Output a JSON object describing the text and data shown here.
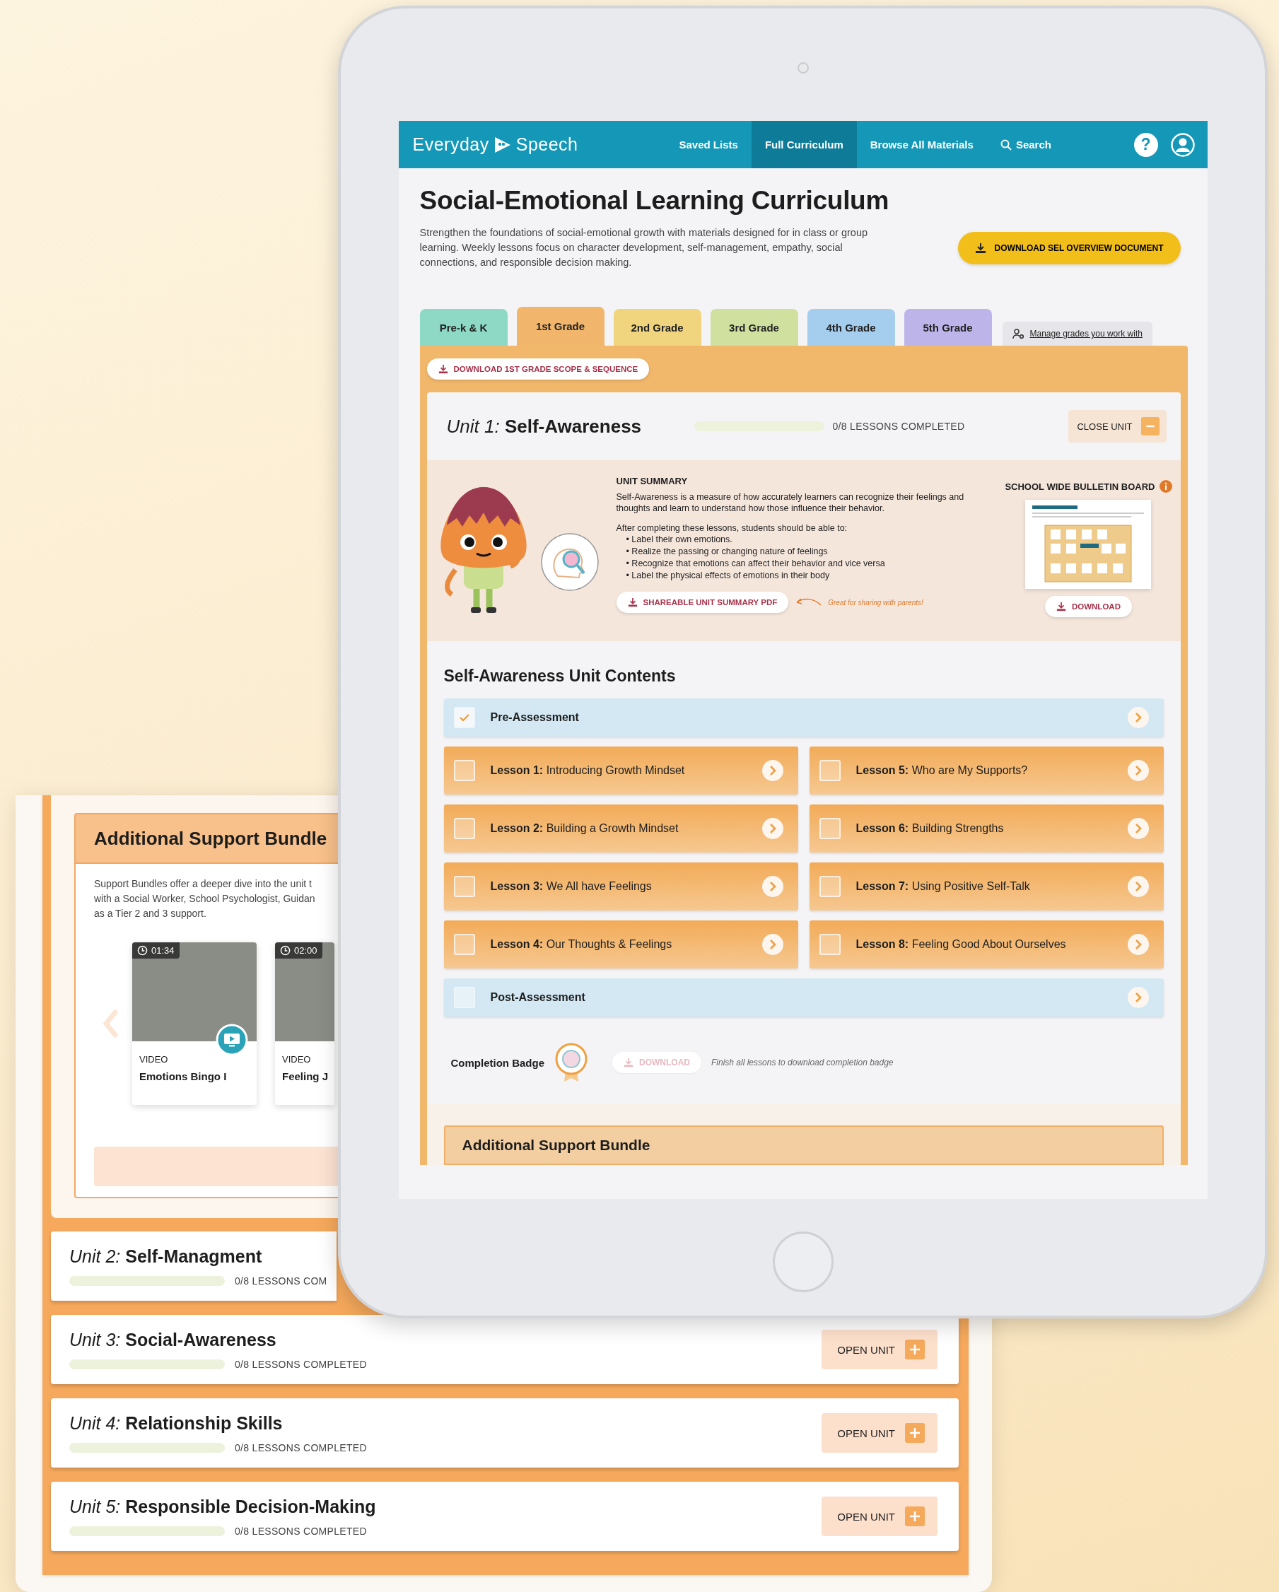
{
  "support_panel": {
    "bundle": {
      "title": "Additional Support Bundle",
      "description": [
        "Support Bundles offer a deeper dive into the unit t",
        "with a Social Worker, School Psychologist, Guidan",
        "as a Tier 2 and 3 support."
      ],
      "videos": [
        {
          "duration": "01:34",
          "type": "VIDEO",
          "title": "Emotions Bingo I",
          "play": true
        },
        {
          "duration": "02:00",
          "type": "VIDEO",
          "title": "Feeling J"
        }
      ]
    },
    "units": [
      {
        "title": "*Unit 2:* **Self-Managment**",
        "level": 0,
        "progress": "0/8 LESSONS COM"
      },
      {
        "title": "*Unit 3:* **Social-Awareness**",
        "level": 0,
        "progress": "0/8 LESSONS COMPLETED",
        "button": "OPEN UNIT"
      },
      {
        "title": "*Unit 4:* **Relationship Skills**",
        "level": 0,
        "progress": "0/8 LESSONS COMPLETED",
        "button": "OPEN UNIT"
      },
      {
        "title": "*Unit 5:* **Responsible Decision-Making**",
        "level": 0,
        "progress": "0/8 LESSONS COMPLETED",
        "button": "OPEN UNIT"
      }
    ]
  },
  "tablet": {
    "nav": {
      "logo_left": "Everyday",
      "logo_right": "Speech",
      "items": [
        {
          "label": "Saved Lists",
          "selected": false
        },
        {
          "label": "Full Curriculum",
          "selected": true
        },
        {
          "label": "Browse All Materials",
          "selected": false
        }
      ],
      "search": "Search",
      "help": "?"
    },
    "title": "Social-Emotional Learning Curriculum",
    "description": "Strengthen the foundations of social-emotional growth with materials designed for in class or group learning. Weekly lessons focus on character development, self-management, empathy, social connections, and responsible decision making.",
    "overview_button": "DOWNLOAD SEL OVERVIEW DOCUMENT",
    "grade_tabs": [
      {
        "label": "Pre-k & K",
        "selected": false,
        "color": "#8ed8c6"
      },
      {
        "label": "1st Grade",
        "selected": true,
        "color": "#f1b66b"
      },
      {
        "label": "2nd Grade",
        "selected": false,
        "color": "#f0d57e"
      },
      {
        "label": "3rd Grade",
        "selected": false,
        "color": "#cfe09f"
      },
      {
        "label": "4th Grade",
        "selected": false,
        "color": "#a4cdee"
      },
      {
        "label": "5th Grade",
        "selected": false,
        "color": "#bdb5ea"
      }
    ],
    "manage_link": "Manage grades you work with",
    "scope_button": "DOWNLOAD 1ST GRADE SCOPE & SEQUENCE",
    "unit": {
      "title": "*Unit 1:* **Self-Awareness**",
      "level": 0,
      "progress": "0/8 LESSONS COMPLETED",
      "close_button": "CLOSE UNIT",
      "summary": {
        "heading": "UNIT SUMMARY",
        "paragraph": "Self-Awareness is a measure of how accurately learners can recognize their feelings and thoughts and learn to understand how those influence their behavior.",
        "intro": "After completing these lessons, students should be able to:",
        "bullets": [
          "• Label their own emotions.",
          "• Realize the passing or changing nature of feelings",
          "• Recognize that emotions can affect their behavior and vice versa",
          "• Label the physical effects of emotions in their body"
        ],
        "pdf_button": "SHAREABLE UNIT SUMMARY PDF",
        "note": "Great for sharing with parents!"
      },
      "bulletin": {
        "title": "SCHOOL WIDE BULLETIN BOARD",
        "button": "DOWNLOAD"
      },
      "contents_heading": "Self-Awareness Unit Contents",
      "items": [
        {
          "kind": "assessment",
          "text": "**Pre-Assessment**",
          "checked": true
        },
        {
          "kind": "lesson",
          "text": "**Lesson 1:** Introducing Growth Mindset",
          "checked": false
        },
        {
          "kind": "lesson",
          "text": "**Lesson 5:** Who are My Supports?",
          "checked": false
        },
        {
          "kind": "lesson",
          "text": "**Lesson 2:** Building a Growth Mindset",
          "checked": false
        },
        {
          "kind": "lesson",
          "text": "**Lesson 6:** Building Strengths",
          "checked": false
        },
        {
          "kind": "lesson",
          "text": "**Lesson 3:** We All have Feelings",
          "checked": false
        },
        {
          "kind": "lesson",
          "text": "**Lesson 7:** Using Positive Self-Talk",
          "checked": false
        },
        {
          "kind": "lesson",
          "text": "**Lesson 4:** Our Thoughts & Feelings",
          "checked": false
        },
        {
          "kind": "lesson",
          "text": "**Lesson 8:** Feeling Good About Ourselves",
          "checked": false
        },
        {
          "kind": "assessment",
          "text": "**Post-Assessment**",
          "checked": false
        }
      ],
      "completion": {
        "label": "Completion Badge",
        "button": "DOWNLOAD",
        "disabled": true,
        "hint": "Finish all lessons to download completion badge"
      },
      "bundle_title": "Additional Support Bundle"
    }
  }
}
